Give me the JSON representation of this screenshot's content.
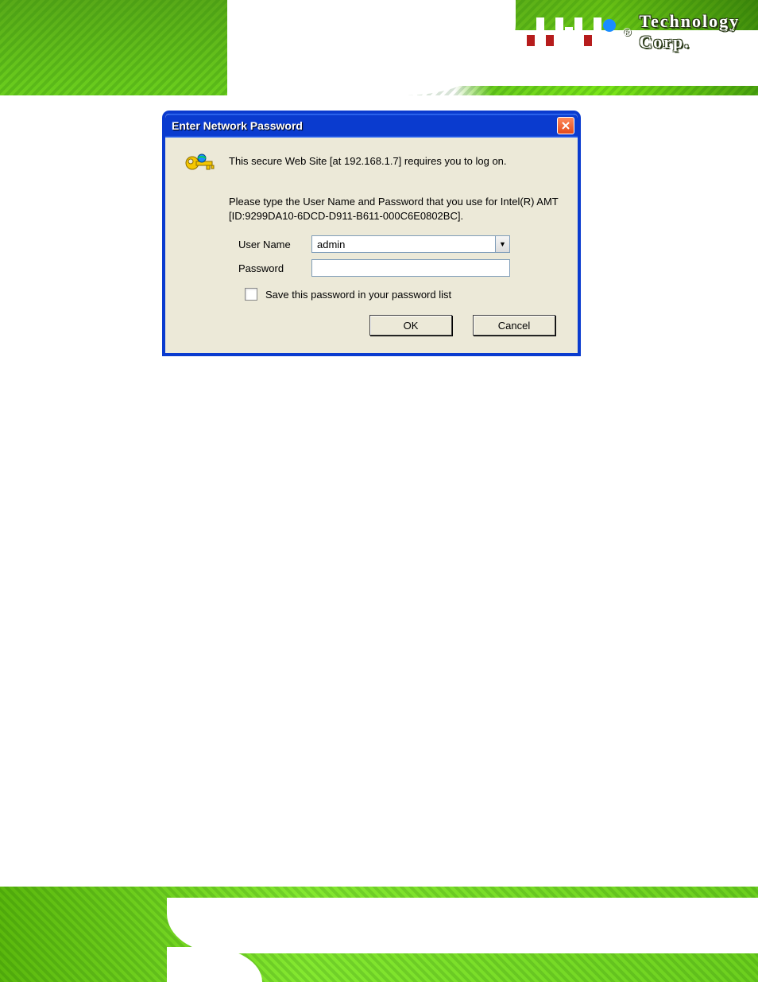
{
  "header": {
    "brand_text": "Technology Corp.",
    "registered": "®"
  },
  "dialog": {
    "title": "Enter Network Password",
    "msg_line1": "This secure Web Site [at 192.168.1.7] requires you to log on.",
    "msg_line2": "Please type the User Name and Password that you use for Intel(R) AMT [ID:9299DA10-6DCD-D911-B611-000C6E0802BC].",
    "labels": {
      "username": "User Name",
      "password": "Password"
    },
    "values": {
      "username": "admin",
      "password": ""
    },
    "checkbox_label": "Save this password in your password list",
    "buttons": {
      "ok": "OK",
      "cancel": "Cancel"
    }
  }
}
